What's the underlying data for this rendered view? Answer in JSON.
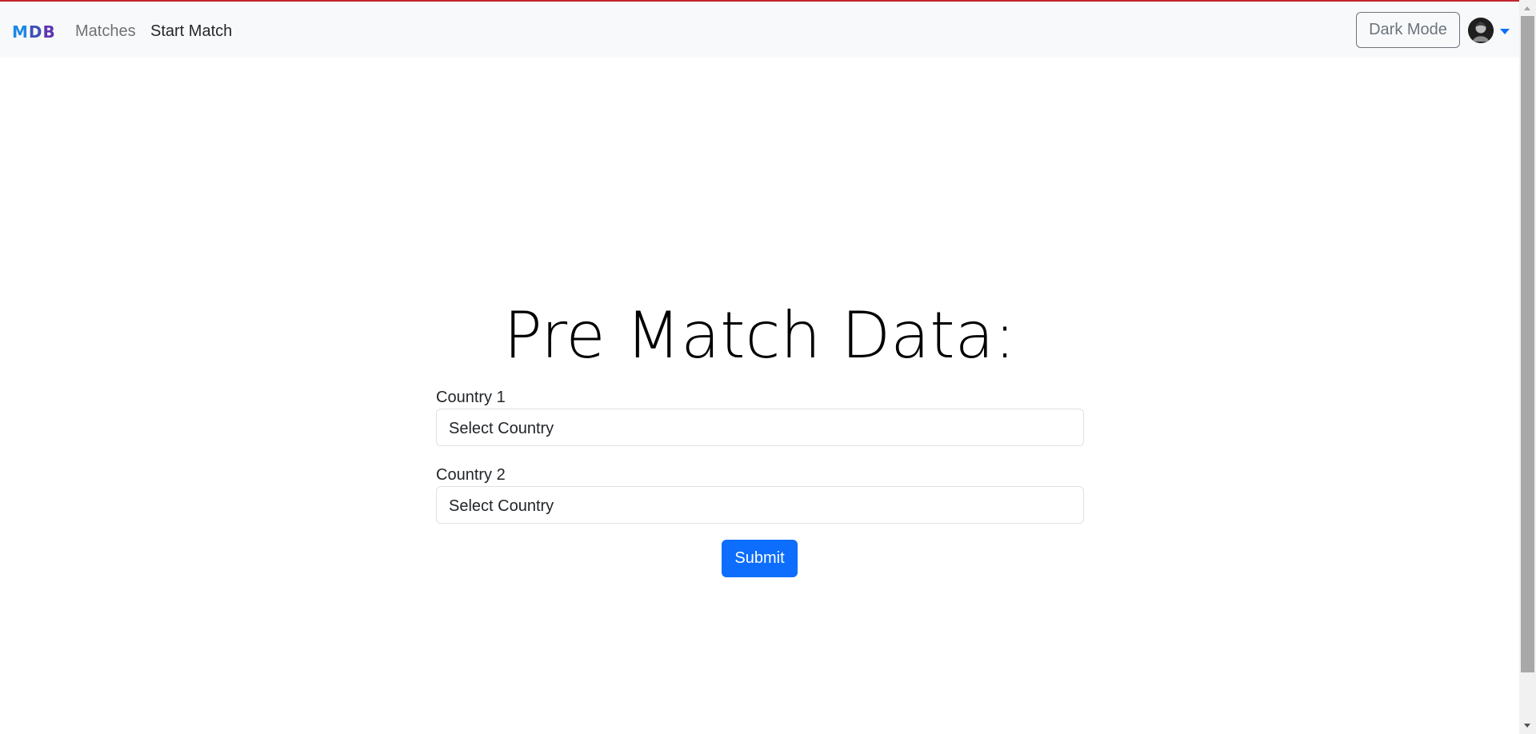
{
  "navbar": {
    "brand": [
      "M",
      "D",
      "B"
    ],
    "links": [
      "Matches",
      "Start Match"
    ],
    "dark_mode_label": "Dark Mode"
  },
  "main": {
    "title": "Pre Match Data:",
    "fields": [
      {
        "label": "Country 1",
        "selected": "Select Country"
      },
      {
        "label": "Country 2",
        "selected": "Select Country"
      }
    ],
    "submit_label": "Submit"
  },
  "colors": {
    "accent": "#0d6efd",
    "top_border": "#c1272d",
    "navbar_bg": "#f8f9fa"
  },
  "icons": [
    "profile-avatar-icon",
    "chevron-down-icon"
  ]
}
